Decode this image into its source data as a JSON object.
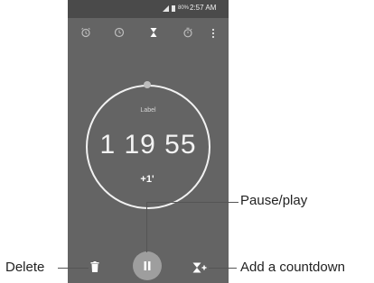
{
  "status_bar": {
    "battery": "80%",
    "time": "2:57 AM"
  },
  "tabs": [
    {
      "icon": "alarm-icon"
    },
    {
      "icon": "clock-icon"
    },
    {
      "icon": "timer-icon",
      "selected": true
    },
    {
      "icon": "stopwatch-icon"
    }
  ],
  "menu": {
    "icon": "more-vert-icon"
  },
  "timer": {
    "label": "Label",
    "time": "1 19 55",
    "add_minute": "+1'"
  },
  "controls": {
    "delete_icon": "trash-icon",
    "pause_icon": "pause-icon",
    "add_countdown_icon": "add-timer-icon"
  },
  "callouts": {
    "pause_play": "Pause/play",
    "delete": "Delete",
    "add_countdown": "Add a countdown"
  },
  "colors": {
    "screen_background": "#646464",
    "status_bar": "#4a4a4a",
    "pause_button": "#9e9e9e",
    "foreground": "#f2f2f2"
  }
}
